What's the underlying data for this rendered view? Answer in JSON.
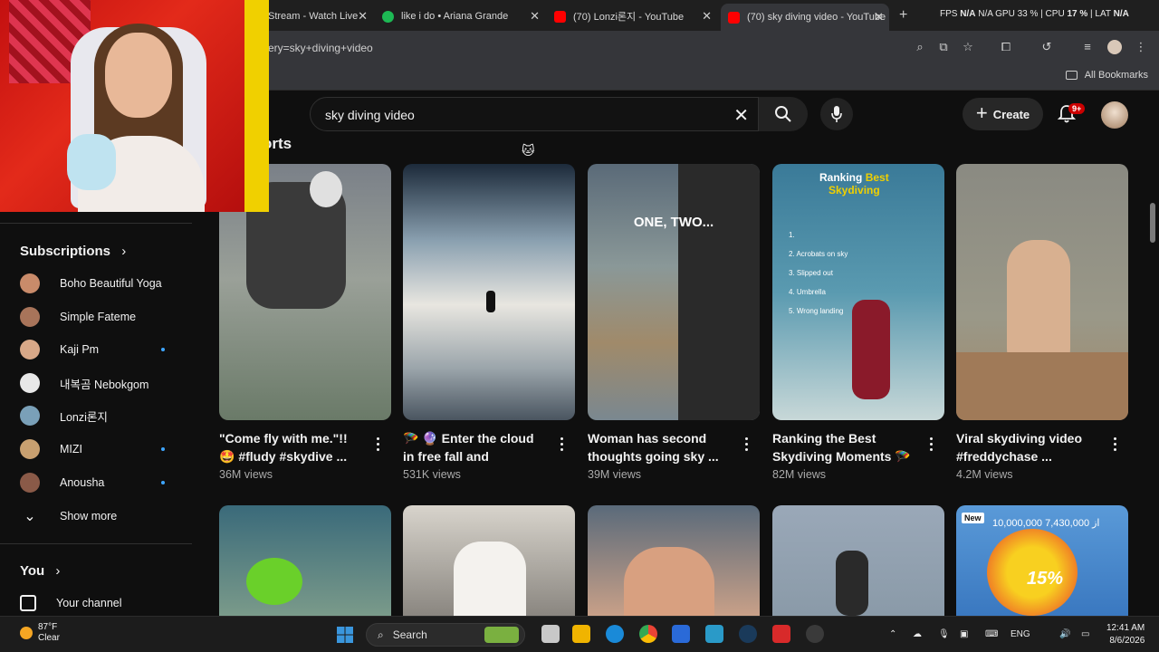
{
  "tabs": [
    {
      "label": "Stream - Watch Live"
    },
    {
      "label": "like i do • Ariana Grande"
    },
    {
      "label": "(70) Lonzi론지 - YouTube"
    },
    {
      "label": "(70) sky diving video - YouTube"
    }
  ],
  "system_stats": {
    "fps_label": "FPS",
    "fps": "N/A",
    "gpu_text": "N/A GPU 33 %",
    "cpu_label": "CPU",
    "cpu": "17 %",
    "lat_label": "LAT",
    "lat": "N/A"
  },
  "address": {
    "url": "ery=sky+diving+video"
  },
  "bookmarks": {
    "label": "All Bookmarks"
  },
  "search": {
    "query": "sky diving video"
  },
  "header": {
    "create_label": "Create",
    "notif_badge": "9+"
  },
  "section": {
    "title": "orts"
  },
  "sidebar": {
    "subscriptions_heading": "Subscriptions",
    "channels": [
      {
        "name": "Boho Beautiful Yoga",
        "color": "#c98b6a",
        "new": false
      },
      {
        "name": "Simple Fateme",
        "color": "#a8745a",
        "new": false
      },
      {
        "name": "Kaji Pm",
        "color": "#d8a888",
        "new": true
      },
      {
        "name": "내복곰 Nebokgom",
        "color": "#e8e8e8",
        "new": false
      },
      {
        "name": "Lonzi론지",
        "color": "#7aa0b8",
        "new": false
      },
      {
        "name": "MIZI",
        "color": "#c8a070",
        "new": true
      },
      {
        "name": "Anousha",
        "color": "#8a5a48",
        "new": true
      }
    ],
    "show_more": "Show more",
    "you_heading": "You",
    "your_channel": "Your channel"
  },
  "videos": [
    {
      "title": "\"Come fly with me.\"!! 🤩 #fludy #skydive ...",
      "views": "36M views"
    },
    {
      "title": "🪂 🔮 Enter the cloud in free fall and skydiving...",
      "views": "531K views"
    },
    {
      "title": "Woman has second thoughts going sky ...",
      "views": "39M views",
      "overlay": "ONE, TWO..."
    },
    {
      "title": "Ranking the Best Skydiving Moments 🪂",
      "views": "82M views",
      "overlay_a": "Ranking",
      "overlay_b": "Best",
      "overlay_c": "Skydiving",
      "list": [
        "1.",
        "2. Acrobats on sky",
        "3. Slipped out",
        "4. Umbrella",
        "5. Wrong landing"
      ]
    },
    {
      "title": "Viral skydiving video #freddychase ...",
      "views": "4.2M views"
    }
  ],
  "row2": {
    "badge": "New",
    "overlay_num": "10,000,000 از 7,430,000",
    "percent": "15%"
  },
  "taskbar": {
    "temp": "87°F",
    "condition": "Clear",
    "search_label": "Search",
    "lang": "ENG",
    "time": "12:41 AM",
    "date": "8/6/2026"
  },
  "colors": {
    "bg": "#0f0f0f",
    "accent_red": "#cc0000",
    "blue_dot": "#3ea6ff"
  }
}
